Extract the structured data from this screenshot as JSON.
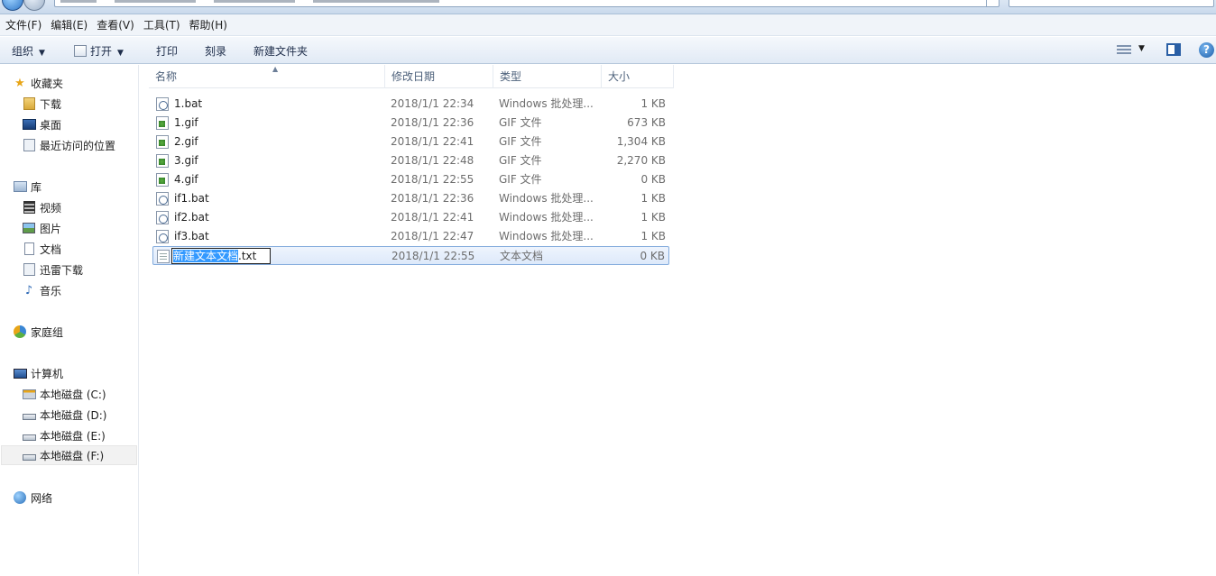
{
  "menu": {
    "items": [
      "文件(F)",
      "编辑(E)",
      "查看(V)",
      "工具(T)",
      "帮助(H)"
    ]
  },
  "toolbar": {
    "organize": "组织",
    "open": "打开",
    "print": "打印",
    "burn": "刻录",
    "new_folder": "新建文件夹"
  },
  "nav": {
    "favorites": "收藏夹",
    "downloads": "下载",
    "desktop": "桌面",
    "recent": "最近访问的位置",
    "libraries": "库",
    "videos": "视频",
    "pictures": "图片",
    "documents": "文档",
    "thunder": "迅雷下载",
    "music": "音乐",
    "homegroup": "家庭组",
    "computer": "计算机",
    "drive_c": "本地磁盘 (C:)",
    "drive_d": "本地磁盘 (D:)",
    "drive_e": "本地磁盘 (E:)",
    "drive_f": "本地磁盘 (F:)",
    "network": "网络"
  },
  "columns": {
    "name": "名称",
    "date": "修改日期",
    "type": "类型",
    "size": "大小"
  },
  "files": [
    {
      "name": "1.bat",
      "date": "2018/1/1 22:34",
      "type": "Windows 批处理...",
      "size": "1 KB",
      "icon": "bat-icon"
    },
    {
      "name": "1.gif",
      "date": "2018/1/1 22:36",
      "type": "GIF 文件",
      "size": "673 KB",
      "icon": "gif-icon"
    },
    {
      "name": "2.gif",
      "date": "2018/1/1 22:41",
      "type": "GIF 文件",
      "size": "1,304 KB",
      "icon": "gif-icon"
    },
    {
      "name": "3.gif",
      "date": "2018/1/1 22:48",
      "type": "GIF 文件",
      "size": "2,270 KB",
      "icon": "gif-icon"
    },
    {
      "name": "4.gif",
      "date": "2018/1/1 22:55",
      "type": "GIF 文件",
      "size": "0 KB",
      "icon": "gif-icon"
    },
    {
      "name": "if1.bat",
      "date": "2018/1/1 22:36",
      "type": "Windows 批处理...",
      "size": "1 KB",
      "icon": "bat-icon"
    },
    {
      "name": "if2.bat",
      "date": "2018/1/1 22:41",
      "type": "Windows 批处理...",
      "size": "1 KB",
      "icon": "bat-icon"
    },
    {
      "name": "if3.bat",
      "date": "2018/1/1 22:47",
      "type": "Windows 批处理...",
      "size": "1 KB",
      "icon": "bat-icon"
    }
  ],
  "editing": {
    "name_selected": "新建文本文档",
    "name_ext": ".txt",
    "date": "2018/1/1 22:55",
    "type": "文本文档",
    "size": "0 KB"
  }
}
